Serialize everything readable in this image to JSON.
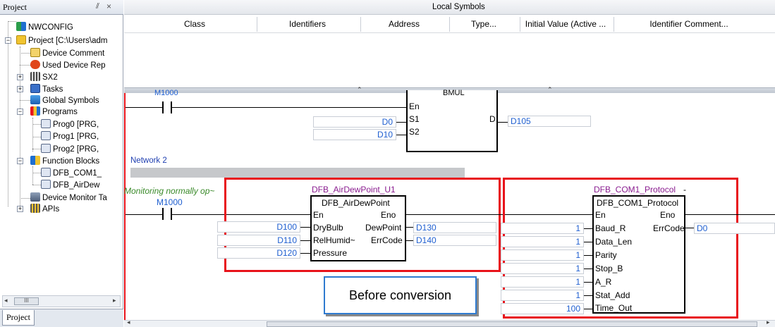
{
  "project_panel": {
    "title": "Project",
    "pin": "⫽",
    "close": "×",
    "tab_label": "Project",
    "tree": [
      {
        "label": "NWCONFIG",
        "icon": "network-config-icon"
      },
      {
        "label": "Project [C:\\Users\\adm",
        "icon": "project-icon"
      },
      {
        "label": "Device Comment",
        "icon": "device-comment-icon"
      },
      {
        "label": "Used Device Rep",
        "icon": "used-device-icon"
      },
      {
        "label": "SX2",
        "icon": "plc-icon"
      },
      {
        "label": "Tasks",
        "icon": "tasks-icon"
      },
      {
        "label": "Global Symbols",
        "icon": "global-symbols-icon"
      },
      {
        "label": "Programs",
        "icon": "programs-icon"
      },
      {
        "label": "Prog0 [PRG,",
        "icon": "pou-icon"
      },
      {
        "label": "Prog1 [PRG,",
        "icon": "pou-icon"
      },
      {
        "label": "Prog2 [PRG,",
        "icon": "pou-icon"
      },
      {
        "label": "Function Blocks",
        "icon": "function-blocks-icon"
      },
      {
        "label": "DFB_COM1_",
        "icon": "pou-icon"
      },
      {
        "label": "DFB_AirDew",
        "icon": "pou-icon"
      },
      {
        "label": "Device Monitor Ta",
        "icon": "device-monitor-icon"
      },
      {
        "label": "APIs",
        "icon": "apis-icon"
      }
    ],
    "scroll_mid": "III"
  },
  "local_symbols": {
    "title": "Local Symbols",
    "columns": [
      "Class",
      "Identifiers",
      "Address",
      "Type...",
      "Initial Value (Active ...",
      "Identifier Comment..."
    ]
  },
  "ladder": {
    "top_contact": "M1000",
    "bmul": {
      "name": "BMUL",
      "en": "En",
      "s1": "S1",
      "s2": "S2",
      "d": "D",
      "s1_val": "D0",
      "s2_val": "D10",
      "d_val": "D105"
    },
    "network_label": "Network 2",
    "comment": "Monitoring normally op~",
    "contact": "M1000",
    "fb1": {
      "instance": "DFB_AirDewPoint_U1",
      "type": "DFB_AirDewPoint",
      "en": "En",
      "eno": "Eno",
      "inputs": [
        {
          "pin": "DryBulb",
          "value": "D100"
        },
        {
          "pin": "RelHumid~",
          "value": "D110"
        },
        {
          "pin": "Pressure",
          "value": "D120"
        }
      ],
      "outputs": [
        {
          "pin": "DewPoint",
          "value": "D130"
        },
        {
          "pin": "ErrCode",
          "value": "D140"
        }
      ]
    },
    "fb2": {
      "instance": "DFB_COM1_Protocol",
      "instance_suffix": "-",
      "type": "DFB_COM1_Protocol",
      "en": "En",
      "eno": "Eno",
      "inputs": [
        {
          "pin": "Baud_R",
          "value": "1"
        },
        {
          "pin": "Data_Len",
          "value": "1"
        },
        {
          "pin": "Parity",
          "value": "1"
        },
        {
          "pin": "Stop_B",
          "value": "1"
        },
        {
          "pin": "A_R",
          "value": "1"
        },
        {
          "pin": "Stat_Add",
          "value": "1"
        },
        {
          "pin": "Time_Out",
          "value": "100"
        }
      ],
      "outputs": [
        {
          "pin": "ErrCode",
          "value": "D0"
        }
      ]
    },
    "caption": "Before conversion"
  },
  "colors": {
    "highlight_red": "#e8131b",
    "value_blue": "#1f5fd0",
    "instance_purple": "#8a1c8f",
    "comment_green": "#3a8a2a",
    "caption_border": "#2f7bd0"
  }
}
